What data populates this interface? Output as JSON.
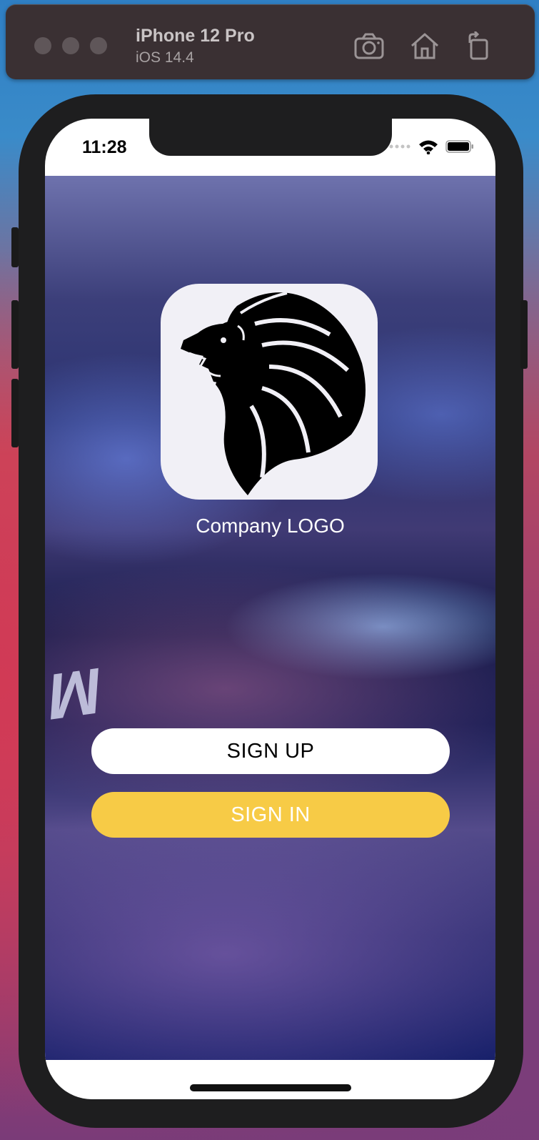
{
  "simulator": {
    "device_name": "iPhone 12 Pro",
    "os_version": "iOS 14.4",
    "icons": [
      "screenshot-icon",
      "home-icon",
      "rotate-icon"
    ]
  },
  "status_bar": {
    "time": "11:28",
    "icons": [
      "cellular-icon",
      "wifi-icon",
      "battery-icon"
    ]
  },
  "app": {
    "logo_label": "Company LOGO",
    "signup_label": "SIGN UP",
    "signin_label": "SIGN IN",
    "colors": {
      "signin_bg": "#f7cb46",
      "signup_bg": "#ffffff",
      "logo_bg": "#f1f0f6"
    }
  }
}
